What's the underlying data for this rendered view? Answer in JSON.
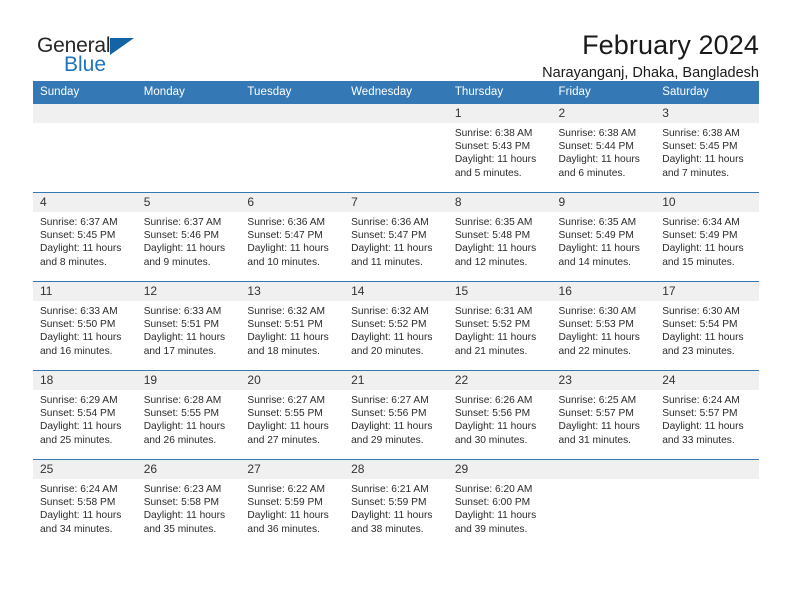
{
  "brand": {
    "name_top": "General",
    "name_bottom": "Blue",
    "triangle_color": "#1464A5",
    "blue_text_color": "#1F74BD"
  },
  "header": {
    "title": "February 2024",
    "location": "Narayanganj, Dhaka, Bangladesh"
  },
  "theme": {
    "header_bg": "#3479B5",
    "header_text": "#FFFFFF",
    "daynum_bg": "#F0F0F0",
    "cell_bg": "#FFFFFF",
    "grid_line": "#3479B5"
  },
  "weekday_headers": [
    "Sunday",
    "Monday",
    "Tuesday",
    "Wednesday",
    "Thursday",
    "Friday",
    "Saturday"
  ],
  "weeks": [
    [
      {
        "day": "",
        "empty": true
      },
      {
        "day": "",
        "empty": true
      },
      {
        "day": "",
        "empty": true
      },
      {
        "day": "",
        "empty": true
      },
      {
        "day": "1",
        "sunrise": "Sunrise: 6:38 AM",
        "sunset": "Sunset: 5:43 PM",
        "daylight": "Daylight: 11 hours and 5 minutes."
      },
      {
        "day": "2",
        "sunrise": "Sunrise: 6:38 AM",
        "sunset": "Sunset: 5:44 PM",
        "daylight": "Daylight: 11 hours and 6 minutes."
      },
      {
        "day": "3",
        "sunrise": "Sunrise: 6:38 AM",
        "sunset": "Sunset: 5:45 PM",
        "daylight": "Daylight: 11 hours and 7 minutes."
      }
    ],
    [
      {
        "day": "4",
        "sunrise": "Sunrise: 6:37 AM",
        "sunset": "Sunset: 5:45 PM",
        "daylight": "Daylight: 11 hours and 8 minutes."
      },
      {
        "day": "5",
        "sunrise": "Sunrise: 6:37 AM",
        "sunset": "Sunset: 5:46 PM",
        "daylight": "Daylight: 11 hours and 9 minutes."
      },
      {
        "day": "6",
        "sunrise": "Sunrise: 6:36 AM",
        "sunset": "Sunset: 5:47 PM",
        "daylight": "Daylight: 11 hours and 10 minutes."
      },
      {
        "day": "7",
        "sunrise": "Sunrise: 6:36 AM",
        "sunset": "Sunset: 5:47 PM",
        "daylight": "Daylight: 11 hours and 11 minutes."
      },
      {
        "day": "8",
        "sunrise": "Sunrise: 6:35 AM",
        "sunset": "Sunset: 5:48 PM",
        "daylight": "Daylight: 11 hours and 12 minutes."
      },
      {
        "day": "9",
        "sunrise": "Sunrise: 6:35 AM",
        "sunset": "Sunset: 5:49 PM",
        "daylight": "Daylight: 11 hours and 14 minutes."
      },
      {
        "day": "10",
        "sunrise": "Sunrise: 6:34 AM",
        "sunset": "Sunset: 5:49 PM",
        "daylight": "Daylight: 11 hours and 15 minutes."
      }
    ],
    [
      {
        "day": "11",
        "sunrise": "Sunrise: 6:33 AM",
        "sunset": "Sunset: 5:50 PM",
        "daylight": "Daylight: 11 hours and 16 minutes."
      },
      {
        "day": "12",
        "sunrise": "Sunrise: 6:33 AM",
        "sunset": "Sunset: 5:51 PM",
        "daylight": "Daylight: 11 hours and 17 minutes."
      },
      {
        "day": "13",
        "sunrise": "Sunrise: 6:32 AM",
        "sunset": "Sunset: 5:51 PM",
        "daylight": "Daylight: 11 hours and 18 minutes."
      },
      {
        "day": "14",
        "sunrise": "Sunrise: 6:32 AM",
        "sunset": "Sunset: 5:52 PM",
        "daylight": "Daylight: 11 hours and 20 minutes."
      },
      {
        "day": "15",
        "sunrise": "Sunrise: 6:31 AM",
        "sunset": "Sunset: 5:52 PM",
        "daylight": "Daylight: 11 hours and 21 minutes."
      },
      {
        "day": "16",
        "sunrise": "Sunrise: 6:30 AM",
        "sunset": "Sunset: 5:53 PM",
        "daylight": "Daylight: 11 hours and 22 minutes."
      },
      {
        "day": "17",
        "sunrise": "Sunrise: 6:30 AM",
        "sunset": "Sunset: 5:54 PM",
        "daylight": "Daylight: 11 hours and 23 minutes."
      }
    ],
    [
      {
        "day": "18",
        "sunrise": "Sunrise: 6:29 AM",
        "sunset": "Sunset: 5:54 PM",
        "daylight": "Daylight: 11 hours and 25 minutes."
      },
      {
        "day": "19",
        "sunrise": "Sunrise: 6:28 AM",
        "sunset": "Sunset: 5:55 PM",
        "daylight": "Daylight: 11 hours and 26 minutes."
      },
      {
        "day": "20",
        "sunrise": "Sunrise: 6:27 AM",
        "sunset": "Sunset: 5:55 PM",
        "daylight": "Daylight: 11 hours and 27 minutes."
      },
      {
        "day": "21",
        "sunrise": "Sunrise: 6:27 AM",
        "sunset": "Sunset: 5:56 PM",
        "daylight": "Daylight: 11 hours and 29 minutes."
      },
      {
        "day": "22",
        "sunrise": "Sunrise: 6:26 AM",
        "sunset": "Sunset: 5:56 PM",
        "daylight": "Daylight: 11 hours and 30 minutes."
      },
      {
        "day": "23",
        "sunrise": "Sunrise: 6:25 AM",
        "sunset": "Sunset: 5:57 PM",
        "daylight": "Daylight: 11 hours and 31 minutes."
      },
      {
        "day": "24",
        "sunrise": "Sunrise: 6:24 AM",
        "sunset": "Sunset: 5:57 PM",
        "daylight": "Daylight: 11 hours and 33 minutes."
      }
    ],
    [
      {
        "day": "25",
        "sunrise": "Sunrise: 6:24 AM",
        "sunset": "Sunset: 5:58 PM",
        "daylight": "Daylight: 11 hours and 34 minutes."
      },
      {
        "day": "26",
        "sunrise": "Sunrise: 6:23 AM",
        "sunset": "Sunset: 5:58 PM",
        "daylight": "Daylight: 11 hours and 35 minutes."
      },
      {
        "day": "27",
        "sunrise": "Sunrise: 6:22 AM",
        "sunset": "Sunset: 5:59 PM",
        "daylight": "Daylight: 11 hours and 36 minutes."
      },
      {
        "day": "28",
        "sunrise": "Sunrise: 6:21 AM",
        "sunset": "Sunset: 5:59 PM",
        "daylight": "Daylight: 11 hours and 38 minutes."
      },
      {
        "day": "29",
        "sunrise": "Sunrise: 6:20 AM",
        "sunset": "Sunset: 6:00 PM",
        "daylight": "Daylight: 11 hours and 39 minutes."
      },
      {
        "day": "",
        "empty": true
      },
      {
        "day": "",
        "empty": true
      }
    ]
  ]
}
